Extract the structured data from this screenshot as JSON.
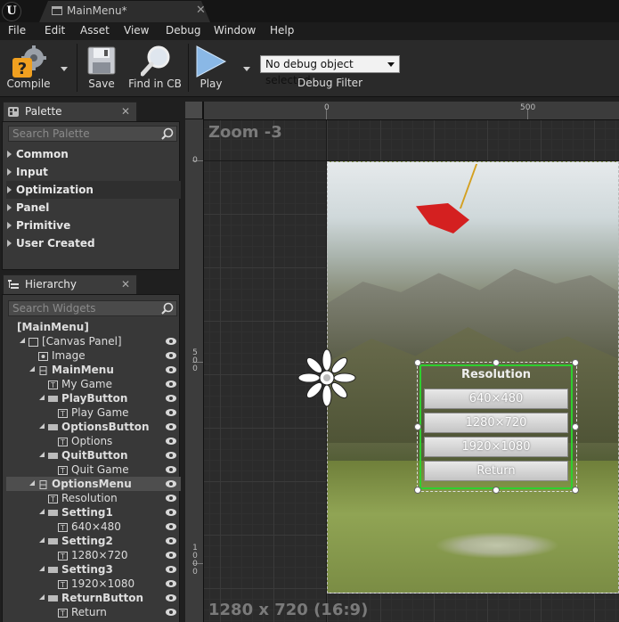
{
  "window": {
    "logo": "U",
    "tab_label": "MainMenu*",
    "tab_close": "✕"
  },
  "menubar": [
    "File",
    "Edit",
    "Asset",
    "View",
    "Debug",
    "Window",
    "Help"
  ],
  "toolbar": {
    "compile": "Compile",
    "save": "Save",
    "find": "Find in CB",
    "play": "Play",
    "debug_select": "No debug object selected",
    "debug_filter": "Debug Filter"
  },
  "palette": {
    "tab": "Palette",
    "close": "✕",
    "search_placeholder": "Search Palette",
    "categories": [
      "Common",
      "Input",
      "Optimization",
      "Panel",
      "Primitive",
      "User Created"
    ]
  },
  "hierarchy": {
    "tab": "Hierarchy",
    "close": "✕",
    "search_placeholder": "Search Widgets",
    "rows": [
      {
        "label": "[MainMenu]",
        "bold": true
      },
      {
        "label": "[Canvas Panel]"
      },
      {
        "label": "Image"
      },
      {
        "label": "MainMenu",
        "bold": true
      },
      {
        "label": "My Game"
      },
      {
        "label": "PlayButton",
        "bold": true
      },
      {
        "label": "Play Game"
      },
      {
        "label": "OptionsButton",
        "bold": true
      },
      {
        "label": "Options"
      },
      {
        "label": "QuitButton",
        "bold": true
      },
      {
        "label": "Quit Game"
      },
      {
        "label": "OptionsMenu",
        "bold": true,
        "selected": true
      },
      {
        "label": "Resolution"
      },
      {
        "label": "Setting1",
        "bold": true
      },
      {
        "label": "640×480"
      },
      {
        "label": "Setting2",
        "bold": true
      },
      {
        "label": "1280×720"
      },
      {
        "label": "Setting3",
        "bold": true
      },
      {
        "label": "1920×1080"
      },
      {
        "label": "ReturnButton",
        "bold": true
      },
      {
        "label": "Return"
      }
    ]
  },
  "designer": {
    "zoom": "Zoom -3",
    "resolution": "1280 x 720 (16:9)",
    "ruler_top": [
      "0",
      "500"
    ],
    "ruler_left": [
      "0",
      "500",
      "1000"
    ]
  },
  "options_widget": {
    "title": "Resolution",
    "buttons": [
      "640×480",
      "1280×720",
      "1920×1080",
      "Return"
    ]
  }
}
